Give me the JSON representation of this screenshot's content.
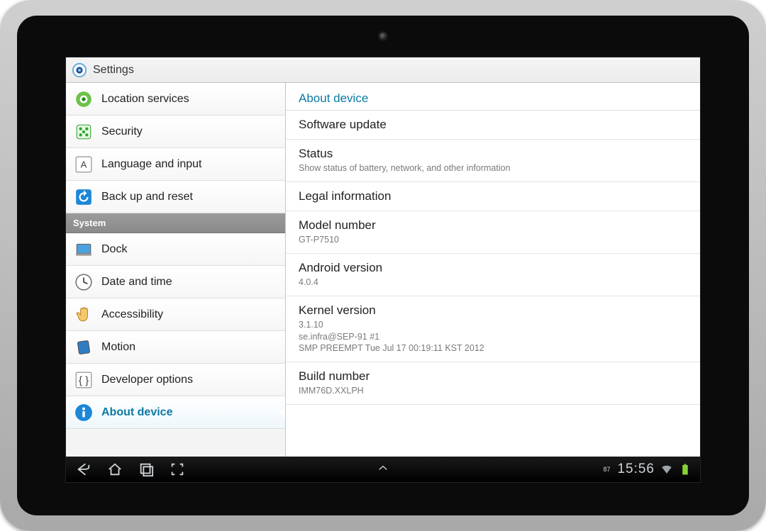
{
  "header": {
    "title": "Settings"
  },
  "sidebar": {
    "items": [
      {
        "id": "location",
        "label": "Location services"
      },
      {
        "id": "security",
        "label": "Security"
      },
      {
        "id": "language",
        "label": "Language and input"
      },
      {
        "id": "backup",
        "label": "Back up and reset"
      }
    ],
    "system_header": "System",
    "system_items": [
      {
        "id": "dock",
        "label": "Dock"
      },
      {
        "id": "datetime",
        "label": "Date and time"
      },
      {
        "id": "accessibility",
        "label": "Accessibility"
      },
      {
        "id": "motion",
        "label": "Motion"
      },
      {
        "id": "developer",
        "label": "Developer options"
      },
      {
        "id": "about",
        "label": "About device",
        "selected": true
      }
    ]
  },
  "detail": {
    "title": "About device",
    "rows": [
      {
        "primary": "Software update"
      },
      {
        "primary": "Status",
        "secondary": "Show status of battery, network, and other information"
      },
      {
        "primary": "Legal information"
      },
      {
        "primary": "Model number",
        "secondary": "GT-P7510",
        "noninteract": true
      },
      {
        "primary": "Android version",
        "secondary": "4.0.4",
        "noninteract": true
      },
      {
        "primary": "Kernel version",
        "secondary": "3.1.10\nse.infra@SEP-91 #1\nSMP PREEMPT Tue Jul 17 00:19:11 KST 2012",
        "noninteract": true
      },
      {
        "primary": "Build number",
        "secondary": "IMM76D.XXLPH",
        "noninteract": true
      }
    ]
  },
  "navbar": {
    "battery": "87",
    "time": "15:56"
  }
}
